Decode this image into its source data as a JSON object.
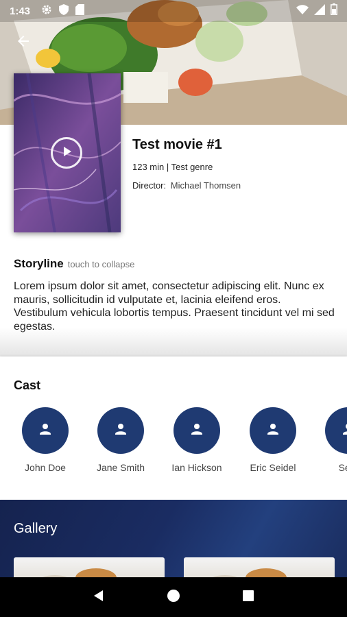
{
  "status_bar": {
    "time": "1:43",
    "left_icons": [
      "gear-icon",
      "shield-icon",
      "sd-card-icon"
    ],
    "right_icons": [
      "wifi-icon",
      "signal-icon",
      "battery-icon"
    ]
  },
  "header": {
    "back_icon": "arrow-left-icon"
  },
  "movie": {
    "title": "Test movie #1",
    "meta": "123 min | Test genre",
    "director_label": "Director:",
    "director_name": "Michael Thomsen"
  },
  "storyline": {
    "title": "Storyline",
    "hint": "touch to collapse",
    "text": "Lorem ipsum dolor sit amet, consectetur adipiscing elit. Nunc ex mauris, sollicitudin id vulputate et, lacinia eleifend eros. Vestibulum vehicula lobortis tempus. Praesent tincidunt vel mi sed egestas."
  },
  "cast": {
    "title": "Cast",
    "members": [
      {
        "name": "John Doe"
      },
      {
        "name": "Jane Smith"
      },
      {
        "name": "Ian Hickson"
      },
      {
        "name": "Eric Seidel"
      },
      {
        "name": "Seth"
      }
    ]
  },
  "gallery": {
    "title": "Gallery"
  },
  "nav": {
    "icons": [
      "back-triangle-icon",
      "home-circle-icon",
      "recents-square-icon"
    ]
  },
  "colors": {
    "accent": "#1f3a72",
    "gallery_bg": "#15234f"
  }
}
